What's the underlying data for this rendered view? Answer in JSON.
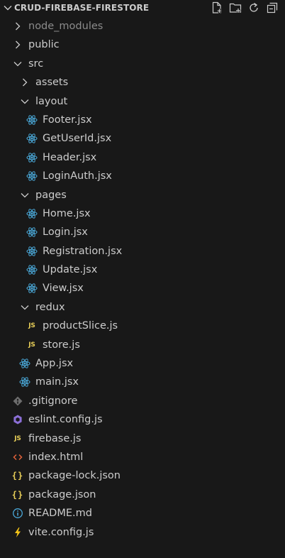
{
  "explorer": {
    "title": "CRUD-FIREBASE-FIRESTORE",
    "actions": [
      {
        "name": "new-file-icon"
      },
      {
        "name": "new-folder-icon"
      },
      {
        "name": "refresh-icon"
      },
      {
        "name": "collapse-all-icon"
      }
    ]
  },
  "tree": [
    {
      "label": "node_modules",
      "depth": 0,
      "kind": "folder",
      "expanded": false,
      "dim": true
    },
    {
      "label": "public",
      "depth": 0,
      "kind": "folder",
      "expanded": false
    },
    {
      "label": "src",
      "depth": 0,
      "kind": "folder",
      "expanded": true
    },
    {
      "label": "assets",
      "depth": 1,
      "kind": "folder",
      "expanded": false
    },
    {
      "label": "layout",
      "depth": 1,
      "kind": "folder",
      "expanded": true
    },
    {
      "label": "Footer.jsx",
      "depth": 2,
      "kind": "file",
      "icon": "react"
    },
    {
      "label": "GetUserId.jsx",
      "depth": 2,
      "kind": "file",
      "icon": "react"
    },
    {
      "label": "Header.jsx",
      "depth": 2,
      "kind": "file",
      "icon": "react"
    },
    {
      "label": "LoginAuth.jsx",
      "depth": 2,
      "kind": "file",
      "icon": "react"
    },
    {
      "label": "pages",
      "depth": 1,
      "kind": "folder",
      "expanded": true
    },
    {
      "label": "Home.jsx",
      "depth": 2,
      "kind": "file",
      "icon": "react"
    },
    {
      "label": "Login.jsx",
      "depth": 2,
      "kind": "file",
      "icon": "react"
    },
    {
      "label": "Registration.jsx",
      "depth": 2,
      "kind": "file",
      "icon": "react"
    },
    {
      "label": "Update.jsx",
      "depth": 2,
      "kind": "file",
      "icon": "react"
    },
    {
      "label": "View.jsx",
      "depth": 2,
      "kind": "file",
      "icon": "react"
    },
    {
      "label": "redux",
      "depth": 1,
      "kind": "folder",
      "expanded": true
    },
    {
      "label": "productSlice.js",
      "depth": 2,
      "kind": "file",
      "icon": "js"
    },
    {
      "label": "store.js",
      "depth": 2,
      "kind": "file",
      "icon": "js"
    },
    {
      "label": "App.jsx",
      "depth": 1,
      "kind": "file",
      "icon": "react"
    },
    {
      "label": "main.jsx",
      "depth": 1,
      "kind": "file",
      "icon": "react"
    },
    {
      "label": ".gitignore",
      "depth": 0,
      "kind": "file",
      "icon": "git"
    },
    {
      "label": "eslint.config.js",
      "depth": 0,
      "kind": "file",
      "icon": "eslint"
    },
    {
      "label": "firebase.js",
      "depth": 0,
      "kind": "file",
      "icon": "js"
    },
    {
      "label": "index.html",
      "depth": 0,
      "kind": "file",
      "icon": "html"
    },
    {
      "label": "package-lock.json",
      "depth": 0,
      "kind": "file",
      "icon": "json"
    },
    {
      "label": "package.json",
      "depth": 0,
      "kind": "file",
      "icon": "json"
    },
    {
      "label": "README.md",
      "depth": 0,
      "kind": "file",
      "icon": "info"
    },
    {
      "label": "vite.config.js",
      "depth": 0,
      "kind": "file",
      "icon": "vite"
    }
  ],
  "colors": {
    "background": "#181818",
    "text": "#cccccc",
    "dim_text": "#8b8b8b",
    "react": "#4aa8d8",
    "js": "#e8cf58",
    "eslint": "#8b6fd6",
    "html": "#e2613a",
    "json": "#e8cf58",
    "info": "#4aa8d8",
    "vite": "#f5c518",
    "git": "#6d6d6d"
  }
}
